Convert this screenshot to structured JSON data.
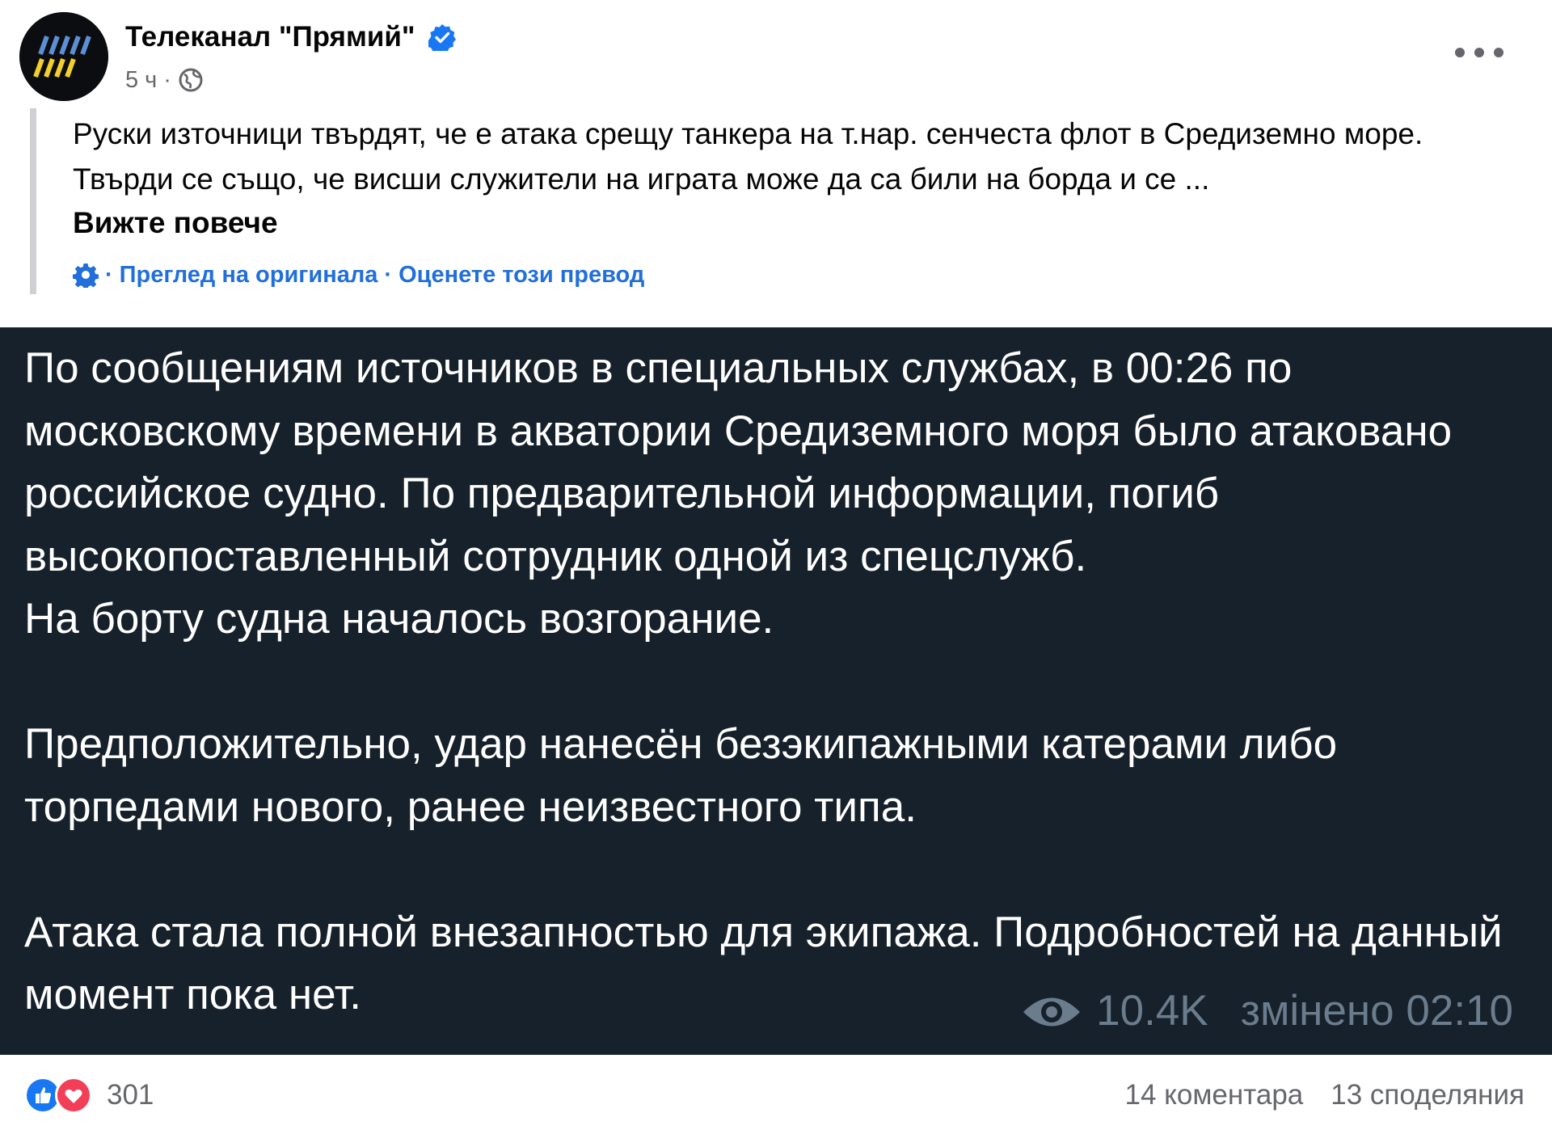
{
  "post": {
    "author": "Телеканал \"Прямий\"",
    "timestamp": "5 ч",
    "separator": "·",
    "verified_icon": "verified-badge-icon",
    "audience_icon": "globe-icon",
    "more_icon": "more-options-icon"
  },
  "translation": {
    "text": "Руски източници твърдят, че е атака срещу танкера на т.нар. сенчеста флот в Средиземно море. Твърди се също, че висши служители на играта може да са били на борда и се ...",
    "see_more": "Вижте повече",
    "settings_icon": "gear-icon",
    "sep1": "·",
    "view_original": "Преглед на оригинала",
    "sep2": "·",
    "rate_translation": "Оценете този превод"
  },
  "image": {
    "text": "По сообщениям источников в специальных службах, в 00:26 по московскому времени в акватории Средиземного моря было атаковано российское судно. По предварительной информации, погиб высокопоставленный сотрудник одной из спецслужб.\nНа борту судна началось возгорание.\n\nПредположительно, удар нанесён безэкипажными катерами либо торпедами нового, ранее неизвестного типа.\n\nАтака стала полной внезапностью для экипажа. Подробностей на данный момент пока нет.",
    "views": "10.4K",
    "edited": "змінено 02:10",
    "views_icon": "eye-icon",
    "background_color": "#17212b"
  },
  "engagement": {
    "reactions_count": "301",
    "reaction_icons": [
      "like-icon",
      "love-icon"
    ],
    "comments": "14 коментара",
    "shares": "13 споделяния"
  }
}
